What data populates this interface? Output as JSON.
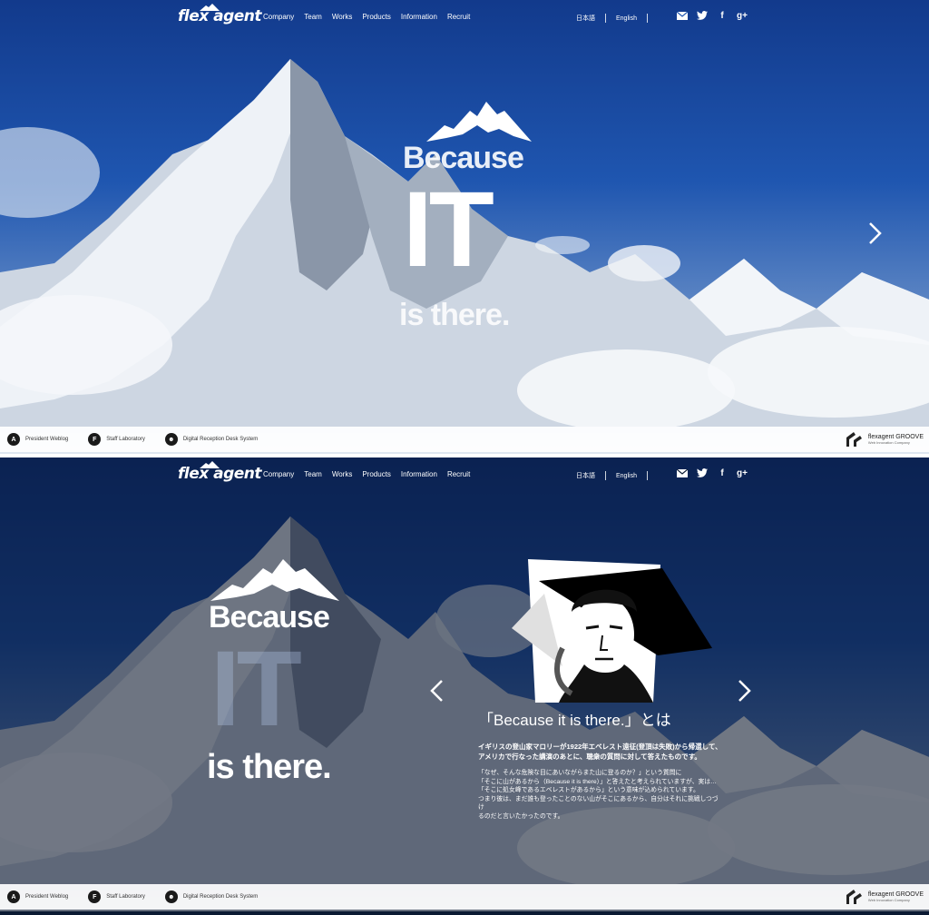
{
  "nav": {
    "logo": "flex agent",
    "menu": [
      "Company",
      "Team",
      "Works",
      "Products",
      "Information",
      "Recruit"
    ],
    "languages": [
      "日本語",
      "English"
    ],
    "social": [
      "mail-icon",
      "twitter-icon",
      "facebook-icon",
      "google-plus-icon"
    ]
  },
  "hero": {
    "line1": "Because",
    "line2": "IT",
    "line3": "is there."
  },
  "about": {
    "title": "「Because it is there.」とは",
    "lead": [
      "イギリスの登山家マロリーが1922年エベレスト遠征(登頂は失敗)から帰還して、",
      "アメリカで行なった講演のあとに、聴衆の質問に対して答えたものです。"
    ],
    "body": [
      "「なぜ、そんな危険な目にあいながらまた山に登るのか？」という質問に",
      "「そこに山があるから（Because it is there）」と答えたと考えられていますが、実は…",
      "「そこに処女峰であるエベレストがあるから」という意味が込められています。",
      "つまり彼は、まだ誰も登ったことのない山がそこにあるから、自分はそれに挑戦しつづけ",
      "るのだと言いたかったのです。"
    ]
  },
  "footer": {
    "items": [
      {
        "icon": "ak-logo-icon",
        "label": "President Weblog"
      },
      {
        "icon": "staff-lab-icon",
        "label": "Staff Laboratory"
      },
      {
        "icon": "reception-icon",
        "label": "Digital Reception Desk System"
      }
    ],
    "brand": "flexagent GROOVE",
    "brand_sub": "Web Innovation Company"
  }
}
